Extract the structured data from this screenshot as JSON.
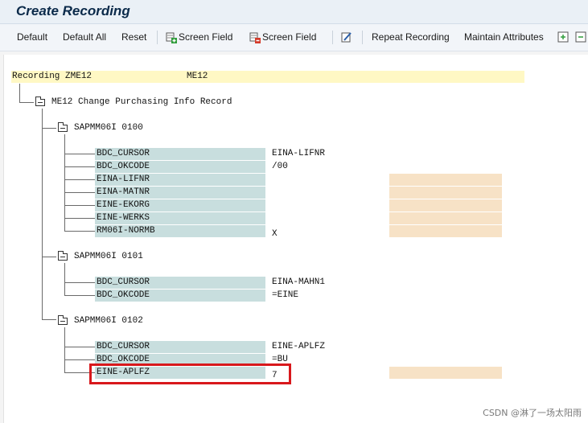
{
  "window": {
    "title": "Create Recording"
  },
  "toolbar": {
    "default": "Default",
    "default_all": "Default All",
    "reset": "Reset",
    "screen_field_insert": "Screen Field",
    "screen_field_delete": "Screen Field",
    "repeat_recording": "Repeat Recording",
    "maintain_attributes": "Maintain Attributes"
  },
  "recording": {
    "label": "Recording ZME12",
    "tcode": "ME12"
  },
  "transaction": {
    "label": "ME12 Change Purchasing Info Record"
  },
  "screens": [
    {
      "label": "SAPMM06I 0100",
      "fields": [
        {
          "name": "BDC_CURSOR",
          "value": "EINA-LIFNR"
        },
        {
          "name": "BDC_OKCODE",
          "value": "/00"
        },
        {
          "name": "EINA-LIFNR",
          "value": ""
        },
        {
          "name": "EINA-MATNR",
          "value": ""
        },
        {
          "name": "EINE-EKORG",
          "value": ""
        },
        {
          "name": "EINE-WERKS",
          "value": ""
        },
        {
          "name": "RM06I-NORMB",
          "value": "X"
        }
      ]
    },
    {
      "label": "SAPMM06I 0101",
      "fields": [
        {
          "name": "BDC_CURSOR",
          "value": "EINA-MAHN1"
        },
        {
          "name": "BDC_OKCODE",
          "value": "=EINE"
        }
      ]
    },
    {
      "label": "SAPMM06I 0102",
      "fields": [
        {
          "name": "BDC_CURSOR",
          "value": "EINE-APLFZ"
        },
        {
          "name": "BDC_OKCODE",
          "value": "=BU"
        },
        {
          "name": "EINE-APLFZ",
          "value": "7"
        }
      ]
    }
  ],
  "watermark": "CSDN @淋了一场太阳雨",
  "colors": {
    "field_name_bg": "#c8dede",
    "highlight_yellow": "#fff8c4",
    "input_orange": "#f7e2c6",
    "annotation_red": "#d8181c"
  }
}
